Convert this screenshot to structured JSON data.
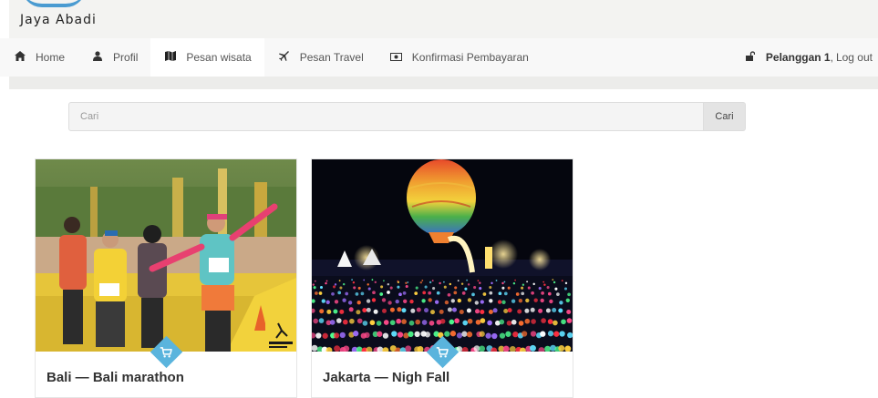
{
  "brand": {
    "name": "Jaya Abadi"
  },
  "nav": {
    "items": [
      {
        "label": "Home",
        "icon": "home-icon"
      },
      {
        "label": "Profil",
        "icon": "user-icon"
      },
      {
        "label": "Pesan wisata",
        "icon": "map-icon",
        "active": true
      },
      {
        "label": "Pesan Travel",
        "icon": "plane-icon"
      },
      {
        "label": "Konfirmasi Pembayaran",
        "icon": "money-icon"
      }
    ],
    "user": {
      "name": "Pelanggan 1",
      "separator": ",",
      "logout": "Log out",
      "icon": "unlock-icon"
    }
  },
  "search": {
    "placeholder": "Cari",
    "value": "",
    "button": "Cari"
  },
  "cards": [
    {
      "title": "Bali — Bali marathon",
      "image": "marathon-photo",
      "action_icon": "cart-icon"
    },
    {
      "title": "Jakarta — Nigh Fall",
      "image": "night-lights-photo",
      "action_icon": "cart-icon"
    }
  ],
  "colors": {
    "accent": "#5ab4dd",
    "navbar_bg": "#f8f8f8",
    "logo_arc": "#4a9bd1"
  }
}
